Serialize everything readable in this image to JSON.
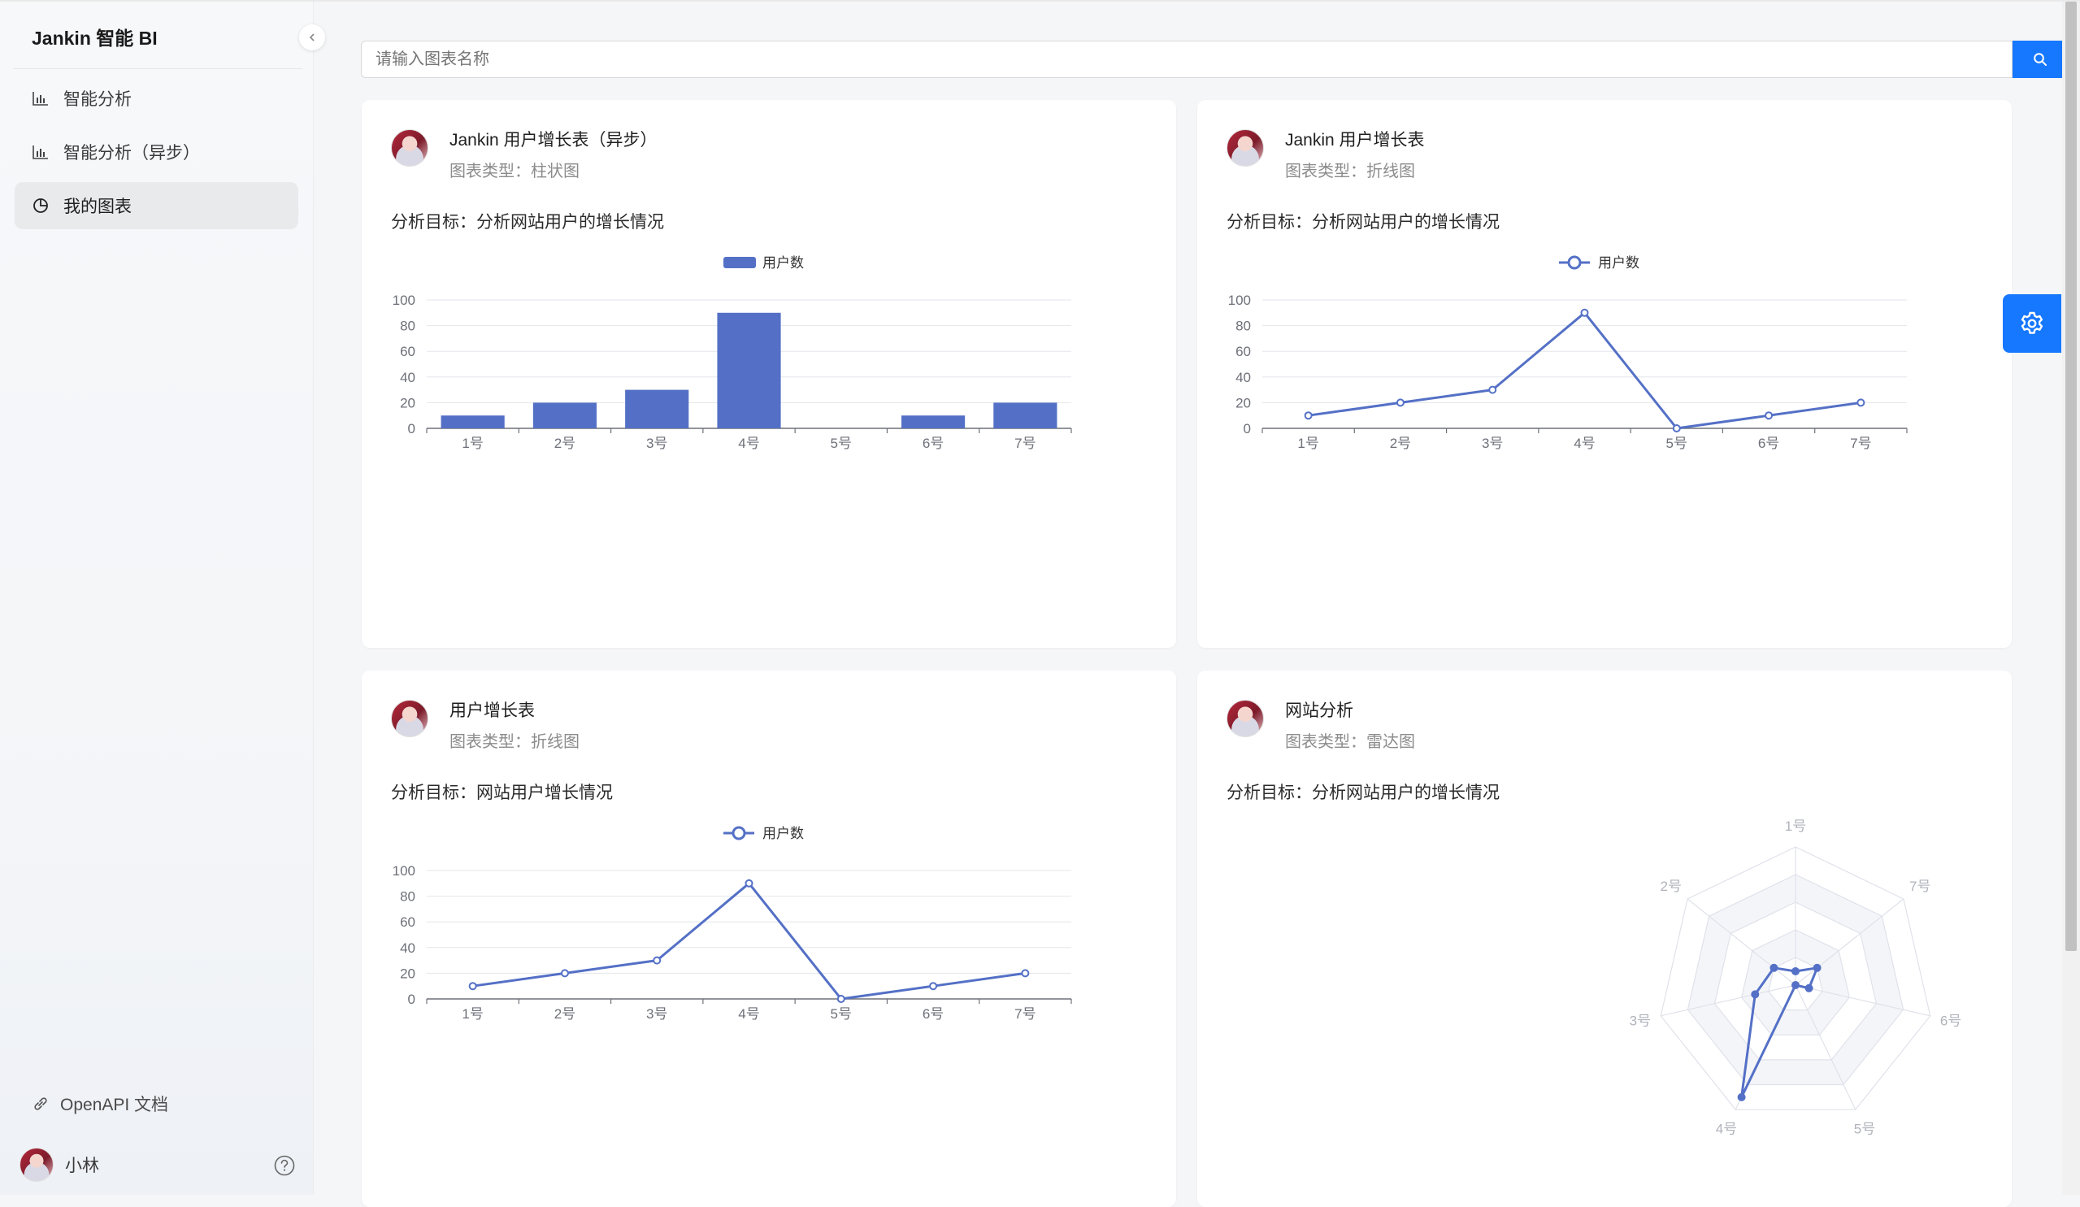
{
  "app": {
    "title": "Jankin 智能 BI"
  },
  "sidebar": {
    "items": [
      {
        "label": "智能分析",
        "icon": "bar-chart-icon",
        "active": false
      },
      {
        "label": "智能分析（异步）",
        "icon": "bar-chart-icon",
        "active": false
      },
      {
        "label": "我的图表",
        "icon": "pie-chart-icon",
        "active": true
      }
    ],
    "footer_link": "OpenAPI 文档",
    "user_name": "小林"
  },
  "search": {
    "placeholder": "请输入图表名称"
  },
  "colors": {
    "accent": "#1677ff",
    "series": "#5470c6"
  },
  "cards": [
    {
      "title": "Jankin 用户增长表（异步）",
      "type_label": "图表类型：柱状图",
      "goal": "分析目标：分析网站用户的增长情况"
    },
    {
      "title": "Jankin 用户增长表",
      "type_label": "图表类型：折线图",
      "goal": "分析目标：分析网站用户的增长情况"
    },
    {
      "title": "用户增长表",
      "type_label": "图表类型：折线图",
      "goal": "分析目标：网站用户增长情况"
    },
    {
      "title": "网站分析",
      "type_label": "图表类型：雷达图",
      "goal": "分析目标：分析网站用户的增长情况"
    }
  ],
  "chart_data": [
    {
      "type": "bar",
      "categories": [
        "1号",
        "2号",
        "3号",
        "4号",
        "5号",
        "6号",
        "7号"
      ],
      "series": [
        {
          "name": "用户数",
          "values": [
            10,
            20,
            30,
            90,
            0,
            10,
            20
          ]
        }
      ],
      "yticks": [
        0,
        20,
        40,
        60,
        80,
        100
      ],
      "ylim": [
        0,
        100
      ],
      "legend": "top-center"
    },
    {
      "type": "line",
      "categories": [
        "1号",
        "2号",
        "3号",
        "4号",
        "5号",
        "6号",
        "7号"
      ],
      "series": [
        {
          "name": "用户数",
          "values": [
            10,
            20,
            30,
            90,
            0,
            10,
            20
          ]
        }
      ],
      "yticks": [
        0,
        20,
        40,
        60,
        80,
        100
      ],
      "ylim": [
        0,
        100
      ],
      "legend": "top-center"
    },
    {
      "type": "line",
      "categories": [
        "1号",
        "2号",
        "3号",
        "4号",
        "5号",
        "6号",
        "7号"
      ],
      "series": [
        {
          "name": "用户数",
          "values": [
            10,
            20,
            30,
            90,
            0,
            10,
            20
          ]
        }
      ],
      "yticks": [
        0,
        20,
        40,
        60,
        80,
        100
      ],
      "ylim": [
        0,
        100
      ],
      "legend": "top-center"
    },
    {
      "type": "radar",
      "categories": [
        "1号",
        "7号",
        "6号",
        "5号",
        "4号",
        "3号",
        "2号"
      ],
      "series": [
        {
          "values": [
            10,
            20,
            10,
            0,
            90,
            30,
            20
          ]
        }
      ],
      "rmax": 100
    }
  ]
}
